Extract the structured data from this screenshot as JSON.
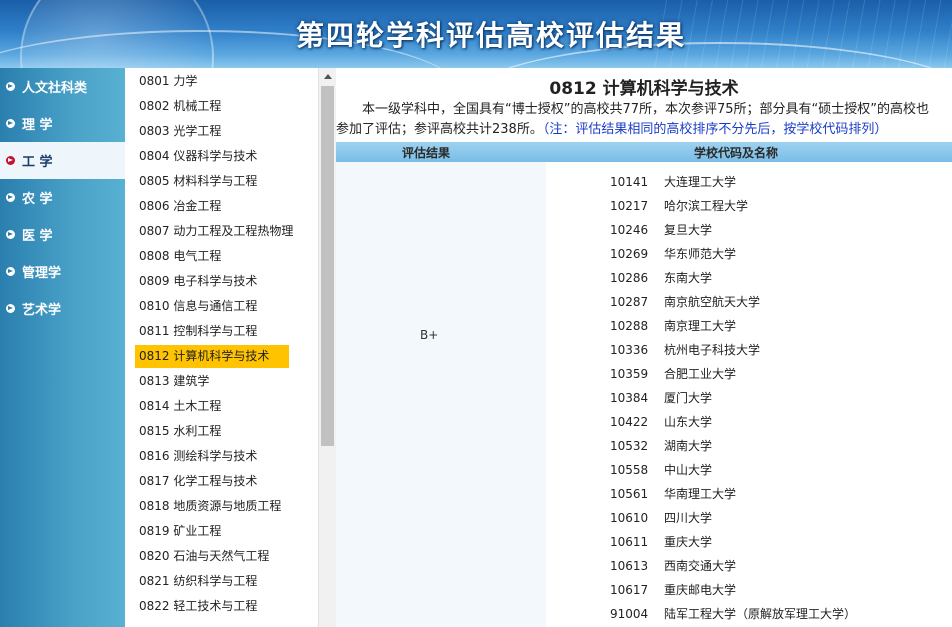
{
  "banner": {
    "title": "第四轮学科评估高校评估结果"
  },
  "categories": [
    {
      "label": "人文社科类",
      "active": false
    },
    {
      "label": "理 学",
      "active": false
    },
    {
      "label": "工 学",
      "active": true
    },
    {
      "label": "农 学",
      "active": false
    },
    {
      "label": "医 学",
      "active": false
    },
    {
      "label": "管理学",
      "active": false
    },
    {
      "label": "艺术学",
      "active": false
    }
  ],
  "subjects": [
    "0801 力学",
    "0802 机械工程",
    "0803 光学工程",
    "0804 仪器科学与技术",
    "0805 材料科学与工程",
    "0806 冶金工程",
    "0807 动力工程及工程热物理",
    "0808 电气工程",
    "0809 电子科学与技术",
    "0810 信息与通信工程",
    "0811 控制科学与工程",
    "0812 计算机科学与技术",
    "0813 建筑学",
    "0814 土木工程",
    "0815 水利工程",
    "0816 测绘科学与技术",
    "0817 化学工程与技术",
    "0818 地质资源与地质工程",
    "0819 矿业工程",
    "0820 石油与天然气工程",
    "0821 纺织科学与工程",
    "0822 轻工技术与工程"
  ],
  "active_subject_index": 11,
  "main": {
    "title": "0812 计算机科学与技术",
    "desc_line1": "本一级学科中，全国具有“博士授权”的高校共77所，本次参评75所；部分具有“硕士授权”的高校也",
    "desc_line2_a": "参加了评估；参评高校共计238所。",
    "desc_line2_note": "（注：评估结果相同的高校排序不分先后，按学校代码排列）",
    "col_grade": "评估结果",
    "col_school": "学校代码及名称",
    "grade": "B+",
    "rows": [
      {
        "code": "10141",
        "name": "大连理工大学"
      },
      {
        "code": "10217",
        "name": "哈尔滨工程大学"
      },
      {
        "code": "10246",
        "name": "复旦大学"
      },
      {
        "code": "10269",
        "name": "华东师范大学"
      },
      {
        "code": "10286",
        "name": "东南大学"
      },
      {
        "code": "10287",
        "name": "南京航空航天大学"
      },
      {
        "code": "10288",
        "name": "南京理工大学"
      },
      {
        "code": "10336",
        "name": "杭州电子科技大学"
      },
      {
        "code": "10359",
        "name": "合肥工业大学"
      },
      {
        "code": "10384",
        "name": "厦门大学"
      },
      {
        "code": "10422",
        "name": "山东大学"
      },
      {
        "code": "10532",
        "name": "湖南大学"
      },
      {
        "code": "10558",
        "name": "中山大学"
      },
      {
        "code": "10561",
        "name": "华南理工大学"
      },
      {
        "code": "10610",
        "name": "四川大学"
      },
      {
        "code": "10611",
        "name": "重庆大学"
      },
      {
        "code": "10613",
        "name": "西南交通大学"
      },
      {
        "code": "10617",
        "name": "重庆邮电大学"
      },
      {
        "code": "91004",
        "name": "陆军工程大学（原解放军理工大学）"
      }
    ]
  },
  "colors": {
    "active_subject": "#ffc300",
    "table_header": "#79bde6",
    "note_text": "#1a3cc8",
    "sidebar": "#2a7fae"
  }
}
